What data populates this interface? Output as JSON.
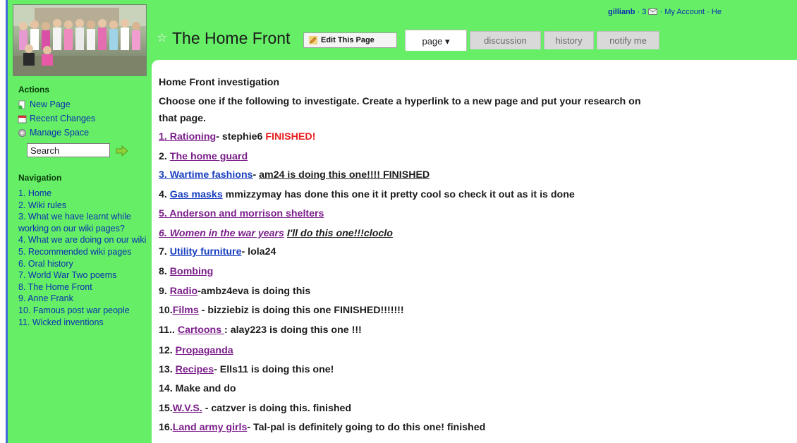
{
  "topbar": {
    "username": "gillianb",
    "sep1": " · 3 ",
    "sep2": " · ",
    "my_account": "My Account",
    "sep3": " · ",
    "help": "He"
  },
  "header": {
    "title": "The Home Front",
    "edit_label": "Edit This Page",
    "tabs": [
      {
        "label": "page ▾"
      },
      {
        "label": "discussion"
      },
      {
        "label": "history"
      },
      {
        "label": "notify me"
      }
    ]
  },
  "sidebar": {
    "actions_heading": "Actions",
    "actions": [
      {
        "label": "New Page"
      },
      {
        "label": "Recent Changes"
      },
      {
        "label": "Manage Space"
      }
    ],
    "search_value": "Search",
    "navigation_heading": "Navigation",
    "nav": [
      "1. Home",
      "2. Wiki rules",
      "3. What we have learnt while working on our wiki pages?",
      "4. What we are doing on our wiki",
      "5. Recommended wiki pages",
      "6. Oral history",
      "7. World War Two poems",
      "8. The Home Front",
      "9. Anne Frank",
      "10. Famous post war people",
      "11. Wicked inventions"
    ]
  },
  "content": {
    "heading": "Home Front investigation",
    "intro_1": "Choose one if the following to investigate. Create a hyperlink to a new page and put your research on",
    "intro_2": "that page.",
    "items": [
      {
        "prefix": "",
        "link": "1. Rationing",
        "note": "- stephie6 ",
        "extra": "FINISHED!"
      },
      {
        "prefix": "2. ",
        "link": "The home guard",
        "note": ""
      },
      {
        "prefix": "",
        "link": "3. Wartime fashions",
        "note": "- ",
        "extra": "am24 is doing this one!!!! FINISHED"
      },
      {
        "prefix": "4. ",
        "link": "Gas masks",
        "note": " mmizzymay has done this one it it pretty cool so check it out as it is done"
      },
      {
        "prefix": "",
        "link": "5. Anderson and morrison shelters",
        "note": ""
      },
      {
        "prefix": "",
        "link": "6. Women in the war years",
        "note": " ",
        "extra": "I'll do this one!!!cloclo"
      },
      {
        "prefix": "7. ",
        "link": "Utility furniture",
        "note": "- lola24"
      },
      {
        "prefix": "8. ",
        "link": "Bombing",
        "note": ""
      },
      {
        "prefix": "9. ",
        "link": "Radio",
        "note": "-ambz4eva is doing this"
      },
      {
        "prefix": "10.",
        "link": "Films",
        "note": " - bizziebiz is doing this one FINISHED!!!!!!!"
      },
      {
        "prefix": "11.. ",
        "link": "Cartoons ",
        "note": ": alay223 is doing this one !!!"
      },
      {
        "prefix": "12. ",
        "link": "Propaganda",
        "note": ""
      },
      {
        "prefix": "13. ",
        "link": "Recipes",
        "note": "- Ells11 is doing this one!"
      },
      {
        "prefix": "14. Make and do",
        "link": "",
        "note": ""
      },
      {
        "prefix": "15.",
        "link": "W.V.S.",
        "note": " - catzver is doing this. finished"
      },
      {
        "prefix": "16.",
        "link": "Land army girls",
        "note": "- Tal-pal is definitely going to do this one! finished"
      }
    ]
  }
}
